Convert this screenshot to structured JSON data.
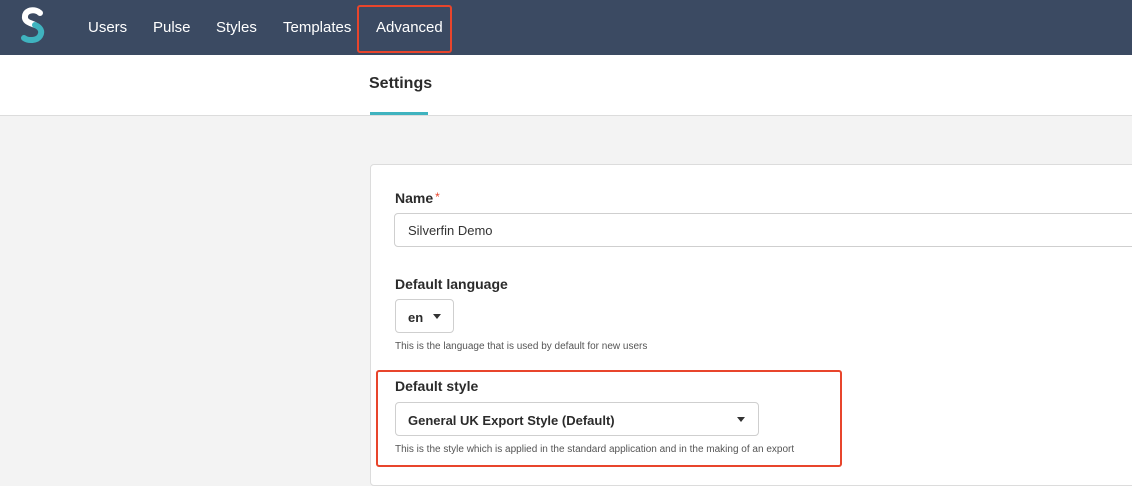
{
  "nav": {
    "logo_icon": "silverfin-s-logo-icon",
    "items": [
      {
        "label": "Users"
      },
      {
        "label": "Pulse"
      },
      {
        "label": "Styles"
      },
      {
        "label": "Templates"
      },
      {
        "label": "Advanced"
      }
    ]
  },
  "subheader": {
    "tab_settings": "Settings"
  },
  "form": {
    "name": {
      "label": "Name",
      "required_mark": "*",
      "value": "Silverfin Demo"
    },
    "default_language": {
      "label": "Default language",
      "selected": "en",
      "help": "This is the language that is used by default for new users"
    },
    "default_style": {
      "label": "Default style",
      "selected": "General UK Export Style (Default)",
      "help": "This is the style which is applied in the standard application and in the making of an export"
    }
  },
  "colors": {
    "nav_bg": "#3b4a62",
    "accent": "#3fb3bf",
    "highlight": "#e8452c"
  }
}
